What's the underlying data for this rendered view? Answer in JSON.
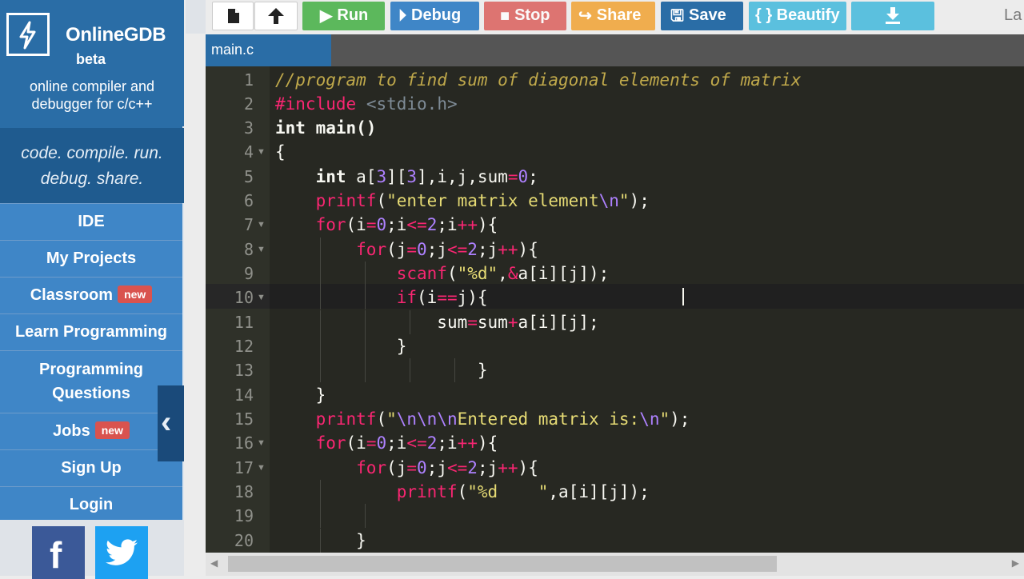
{
  "sidebar": {
    "brand_name": "OnlineGDB",
    "brand_beta": "beta",
    "brand_desc_line1": "online compiler and",
    "brand_desc_line2": "debugger for c/c++",
    "tagline_line1": "code. compile. run.",
    "tagline_line2": "debug. share.",
    "nav": {
      "ide": "IDE",
      "my_projects": "My Projects",
      "classroom": "Classroom",
      "classroom_badge": "new",
      "learn_programming": "Learn Programming",
      "programming_questions_line1": "Programming",
      "programming_questions_line2": "Questions",
      "jobs": "Jobs",
      "jobs_badge": "new",
      "sign_up": "Sign Up",
      "login": "Login"
    },
    "social": {
      "facebook_letter": "f"
    }
  },
  "toolbar": {
    "run": "Run",
    "debug": "Debug",
    "stop": "Stop",
    "share": "Share",
    "save": "Save",
    "beautify": "{ } Beautify",
    "language_partial": "La"
  },
  "tabs": {
    "active": "main.c"
  },
  "editor": {
    "line_numbers": [
      "1",
      "2",
      "3",
      "4",
      "5",
      "6",
      "7",
      "8",
      "9",
      "10",
      "11",
      "12",
      "13",
      "14",
      "15",
      "16",
      "17",
      "18",
      "19",
      "20"
    ],
    "active_line": "10",
    "code": {
      "l1": "//program to find sum of diagonal elements of matrix",
      "l2_directive": "#include",
      "l2_header": "<stdio.h>",
      "l3": "int main()",
      "l4": "{",
      "l5_kw": "int",
      "l5_a": " a[",
      "l5_n1": "3",
      "l5_b": "][",
      "l5_n2": "3",
      "l5_c": "],i,j,sum",
      "l5_eq": "=",
      "l5_n0": "0",
      "l5_end": ";",
      "l6_fn": "printf",
      "l6_open": "(",
      "l6_str": "\"enter matrix element",
      "l6_esc": "\\n",
      "l6_strend": "\"",
      "l6_close": ");",
      "for_kw": "for",
      "l7_a": "(i",
      "l7_rest1": "=",
      "l7_n0": "0",
      "l7_b": ";i",
      "l7_le": "<=",
      "l7_n2": "2",
      "l7_c": ";i",
      "l7_pp": "++",
      "l7_d": "){",
      "l8_a": "(j",
      "l8_b": ";j",
      "l8_c": ";j",
      "l9_fn": "scanf",
      "l9_open": "(",
      "l9_str": "\"%d\"",
      "l9_comma": ",",
      "l9_amp": "&",
      "l9_rest": "a[i][j]);",
      "l10_kw": "if",
      "l10_a": "(i",
      "l10_eqeq": "==",
      "l10_b": "j){",
      "l11_a": "sum",
      "l11_eq": "=",
      "l11_b": "sum",
      "l11_plus": "+",
      "l11_c": "a[i][j];",
      "l12": "}",
      "l13": "}",
      "l14": "}",
      "l15_fn": "printf",
      "l15_open": "(",
      "l15_q": "\"",
      "l15_esc": "\\n\\n\\n",
      "l15_str": "Entered matrix is:",
      "l15_esc2": "\\n",
      "l15_q2": "\"",
      "l15_close": ");",
      "l16_a": "(i",
      "l17_a": "(j",
      "l18_fn": "printf",
      "l18_open": "(",
      "l18_str": "\"%d    \"",
      "l18_rest": ",a[i][j]);",
      "l20": "}"
    }
  },
  "colors": {
    "brand_blue": "#2a6da6",
    "nav_blue": "#3f86c7",
    "run_green": "#5cb85c",
    "stop_red": "#d9534f",
    "share_orange": "#f0ad4e",
    "beautify_cyan": "#5bc0de",
    "editor_bg": "#272822"
  }
}
